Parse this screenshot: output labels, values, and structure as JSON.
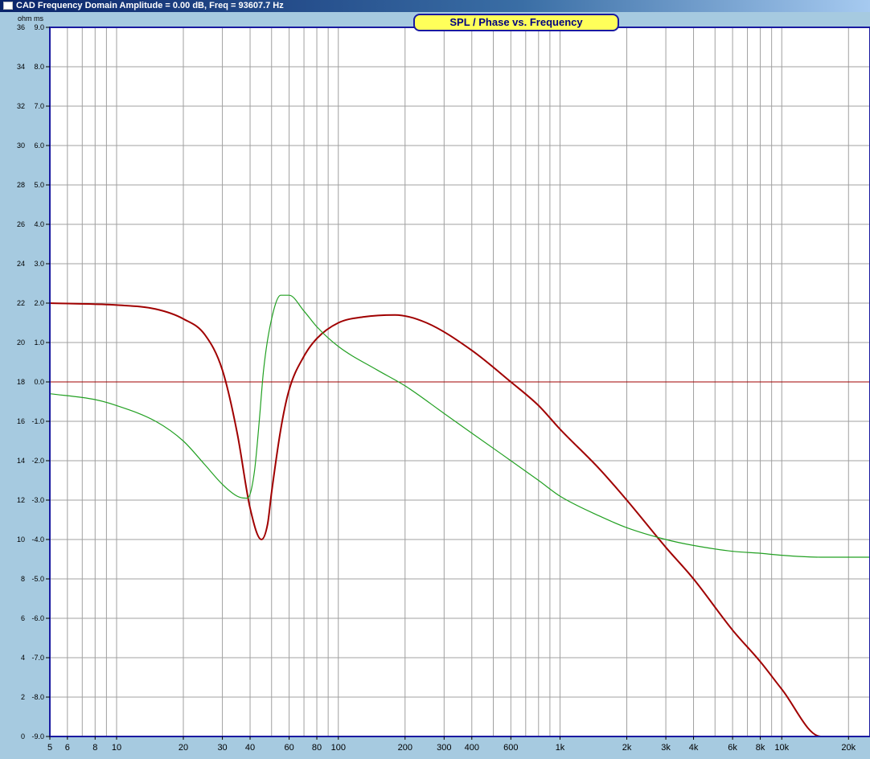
{
  "window": {
    "title": "CAD Frequency Domain   Amplitude = 0.00 dB, Freq = 93607.7 Hz"
  },
  "colors": {
    "background": "#a6cae0",
    "plot_bg": "#ffffff",
    "frame": "#1a1aa0",
    "grid": "#a0a0a0",
    "spl_curve": "#a00000",
    "phase_curve": "#22a022",
    "zero_line": "#a00000"
  },
  "chart_data": {
    "type": "line",
    "title": "SPL / Phase vs. Frequency",
    "xscale": "log",
    "xlim": [
      5,
      25000
    ],
    "x_tick_labels": [
      {
        "value": 5,
        "label": "5"
      },
      {
        "value": 6,
        "label": "6"
      },
      {
        "value": 8,
        "label": "8"
      },
      {
        "value": 10,
        "label": "10"
      },
      {
        "value": 20,
        "label": "20"
      },
      {
        "value": 30,
        "label": "30"
      },
      {
        "value": 40,
        "label": "40"
      },
      {
        "value": 60,
        "label": "60"
      },
      {
        "value": 80,
        "label": "80"
      },
      {
        "value": 100,
        "label": "100"
      },
      {
        "value": 200,
        "label": "200"
      },
      {
        "value": 300,
        "label": "300"
      },
      {
        "value": 400,
        "label": "400"
      },
      {
        "value": 600,
        "label": "600"
      },
      {
        "value": 1000,
        "label": "1k"
      },
      {
        "value": 2000,
        "label": "2k"
      },
      {
        "value": 3000,
        "label": "3k"
      },
      {
        "value": 4000,
        "label": "4k"
      },
      {
        "value": 6000,
        "label": "6k"
      },
      {
        "value": 8000,
        "label": "8k"
      },
      {
        "value": 10000,
        "label": "10k"
      },
      {
        "value": 20000,
        "label": "20k"
      }
    ],
    "left_axis_unit": "ohm",
    "right_axis_unit": "ms",
    "ohm_ticks": [
      "36",
      "34",
      "32",
      "30",
      "28",
      "26",
      "24",
      "22",
      "20",
      "18",
      "16",
      "14",
      "12",
      "10",
      "8",
      "6",
      "4",
      "2",
      "0"
    ],
    "ms_ticks": [
      "9.0",
      "8.0",
      "7.0",
      "6.0",
      "5.0",
      "4.0",
      "3.0",
      "2.0",
      "1.0",
      "0.0",
      "-1.0",
      "-2.0",
      "-3.0",
      "-4.0",
      "-5.0",
      "-6.0",
      "-7.0",
      "-8.0",
      "-9.0"
    ],
    "ylim_ms": [
      -9,
      9
    ],
    "reference_line_ms": 0.0,
    "grid": true,
    "series": [
      {
        "color": "#a00000",
        "x": [
          5,
          10,
          15,
          20,
          25,
          30,
          35,
          40,
          45,
          48,
          50,
          55,
          60,
          70,
          80,
          100,
          130,
          180,
          250,
          400,
          600,
          800,
          1000,
          1500,
          2000,
          3000,
          4000,
          6000,
          8000,
          10000,
          15000,
          20000
        ],
        "y": [
          2.0,
          1.95,
          1.85,
          1.6,
          1.2,
          0.3,
          -1.3,
          -3.2,
          -4.0,
          -3.6,
          -2.8,
          -1.2,
          -0.2,
          0.65,
          1.1,
          1.5,
          1.65,
          1.7,
          1.5,
          0.8,
          0.0,
          -0.6,
          -1.2,
          -2.2,
          -3.0,
          -4.2,
          -5.0,
          -6.3,
          -7.1,
          -7.8,
          -9.0,
          -9.0
        ]
      },
      {
        "color": "#22a022",
        "x": [
          5,
          8,
          10,
          15,
          20,
          25,
          30,
          35,
          38,
          40,
          42,
          44,
          46,
          50,
          55,
          60,
          70,
          80,
          100,
          150,
          200,
          300,
          400,
          600,
          800,
          1000,
          1500,
          2000,
          3000,
          4000,
          6000,
          8000,
          10000,
          15000,
          25000
        ],
        "y": [
          -0.3,
          -0.45,
          -0.6,
          -1.0,
          -1.5,
          -2.1,
          -2.6,
          -2.9,
          -2.95,
          -2.85,
          -2.2,
          -1.0,
          0.3,
          1.6,
          2.2,
          2.2,
          1.8,
          1.4,
          0.9,
          0.3,
          -0.1,
          -0.8,
          -1.3,
          -2.0,
          -2.5,
          -2.9,
          -3.4,
          -3.7,
          -4.0,
          -4.15,
          -4.3,
          -4.35,
          -4.4,
          -4.45,
          -4.45
        ]
      }
    ]
  }
}
